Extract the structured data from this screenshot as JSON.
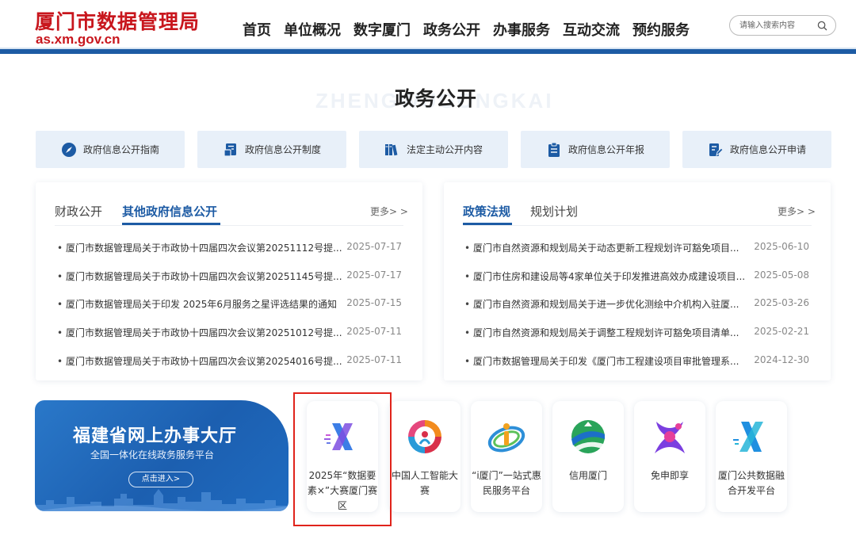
{
  "header": {
    "site_name": "厦门市数据管理局",
    "domain": "as.xm.gov.cn",
    "nav": [
      "首页",
      "单位概况",
      "数字厦门",
      "政务公开",
      "办事服务",
      "互动交流",
      "预约服务"
    ],
    "search_placeholder": "请输入搜索内容",
    "brand_color": "#c8161d",
    "accent_color": "#1d5ba4"
  },
  "section": {
    "bg_word": "ZHENGWUGONGKAI",
    "title": "政务公开"
  },
  "quick_links": [
    {
      "label": "政府信息公开指南",
      "icon": "compass-icon"
    },
    {
      "label": "政府信息公开制度",
      "icon": "document-stamp-icon"
    },
    {
      "label": "法定主动公开内容",
      "icon": "books-icon"
    },
    {
      "label": "政府信息公开年报",
      "icon": "report-icon"
    },
    {
      "label": "政府信息公开申请",
      "icon": "edit-document-icon"
    }
  ],
  "panel_left": {
    "tabs": [
      "财政公开",
      "其他政府信息公开"
    ],
    "active_tab": "其他政府信息公开",
    "more": "更多> >",
    "items": [
      {
        "title": "厦门市数据管理局关于市政协十四届四次会议第20251112号提...",
        "date": "2025-07-17"
      },
      {
        "title": "厦门市数据管理局关于市政协十四届四次会议第20251145号提...",
        "date": "2025-07-17"
      },
      {
        "title": "厦门市数据管理局关于印发 2025年6月服务之星评选结果的通知",
        "date": "2025-07-15"
      },
      {
        "title": "厦门市数据管理局关于市政协十四届四次会议第20251012号提...",
        "date": "2025-07-11"
      },
      {
        "title": "厦门市数据管理局关于市政协十四届四次会议第20254016号提...",
        "date": "2025-07-11"
      }
    ]
  },
  "panel_right": {
    "tabs": [
      "政策法规",
      "规划计划"
    ],
    "active_tab": "政策法规",
    "more": "更多> >",
    "items": [
      {
        "title": "厦门市自然资源和规划局关于动态更新工程规划许可豁免项目...",
        "date": "2025-06-10"
      },
      {
        "title": "厦门市住房和建设局等4家单位关于印发推进高效办成建设项目...",
        "date": "2025-05-08"
      },
      {
        "title": "厦门市自然资源和规划局关于进一步优化测绘中介机构入驻厦...",
        "date": "2025-03-26"
      },
      {
        "title": "厦门市自然资源和规划局关于调整工程规划许可豁免项目清单...",
        "date": "2025-02-21"
      },
      {
        "title": "厦门市数据管理局关于印发《厦门市工程建设项目审批管理系...",
        "date": "2024-12-30"
      }
    ]
  },
  "banner": {
    "title": "福建省网上办事大厅",
    "subtitle": "全国一体化在线政务服务平台",
    "button": "点击进入>"
  },
  "apps": [
    {
      "label": "2025年“数据要素×”大赛厦门赛区",
      "icon": "x-data-icon",
      "highlighted": true
    },
    {
      "label": "中国人工智能大赛",
      "icon": "ai-contest-icon",
      "highlighted": false
    },
    {
      "label": "“i厦门”一站式惠民服务平台",
      "icon": "i-xiamen-icon",
      "highlighted": false
    },
    {
      "label": "信用厦门",
      "icon": "credit-xiamen-icon",
      "highlighted": false
    },
    {
      "label": "免申即享",
      "icon": "free-apply-icon",
      "highlighted": false
    },
    {
      "label": "厦门公共数据融合开发平台",
      "icon": "public-data-x-icon",
      "highlighted": false
    }
  ],
  "highlight_color": "#e0231b"
}
